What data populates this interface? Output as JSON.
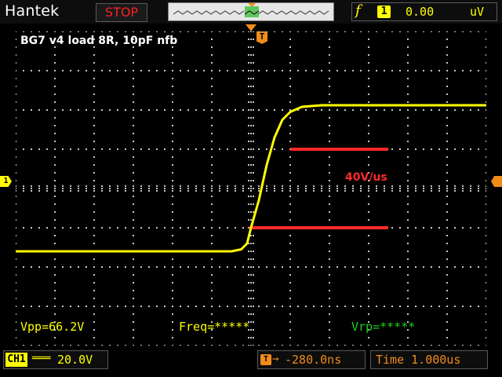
{
  "header": {
    "brand": "Hantek",
    "run_status": "STOP",
    "trigger": {
      "slope_icon": "rising-edge-icon",
      "slope_glyph": "f",
      "channel": "1",
      "level": "0.00",
      "unit": "uV"
    }
  },
  "screen": {
    "note": "BG7 v4 load 8R, 10pF nfb",
    "trigger_marker_label": "T",
    "channel_marker_label": "1",
    "annotation": "40V/us",
    "measurements": {
      "vpp": "Vpp=66.2V",
      "freq": "Freq=*****",
      "vrp": "Vrp=*****"
    }
  },
  "footer": {
    "channel_tag": "CH1",
    "coupling": "═══",
    "volts_div": "20.0V",
    "trigger_icon_label": "T",
    "position_arrow": "→",
    "position": "-280.0ns",
    "timebase": "Time 1.000us"
  },
  "colors": {
    "trace": "#ffff00",
    "grid": "#c8c8c8",
    "status": "#ff2020",
    "trigger_accent": "#f08c1a",
    "annotation": "#ff2a2a",
    "vrp_text": "#22cc22"
  },
  "chart_data": {
    "type": "line",
    "xlabel": "",
    "ylabel": "",
    "x_div_range": [
      0,
      12
    ],
    "y_div_range": [
      -4,
      4
    ],
    "series": [
      {
        "values_div": [
          [
            0,
            -1.6
          ],
          [
            5.5,
            -1.6
          ],
          [
            5.75,
            -1.55
          ],
          [
            5.9,
            -1.4
          ],
          [
            6.0,
            -1.0
          ],
          [
            6.2,
            -0.3
          ],
          [
            6.4,
            0.6
          ],
          [
            6.6,
            1.3
          ],
          [
            6.8,
            1.75
          ],
          [
            7.0,
            1.95
          ],
          [
            7.3,
            2.08
          ],
          [
            7.8,
            2.12
          ],
          [
            8.5,
            2.12
          ],
          [
            12,
            2.12
          ]
        ]
      }
    ],
    "annotations": [
      {
        "text": "40V/us",
        "type": "slew-markers",
        "lower_y_div": -1.0,
        "upper_y_div": 1.0,
        "lower_x_div": [
          5.95,
          9.5
        ],
        "upper_x_div": [
          7.0,
          9.5
        ]
      }
    ]
  }
}
